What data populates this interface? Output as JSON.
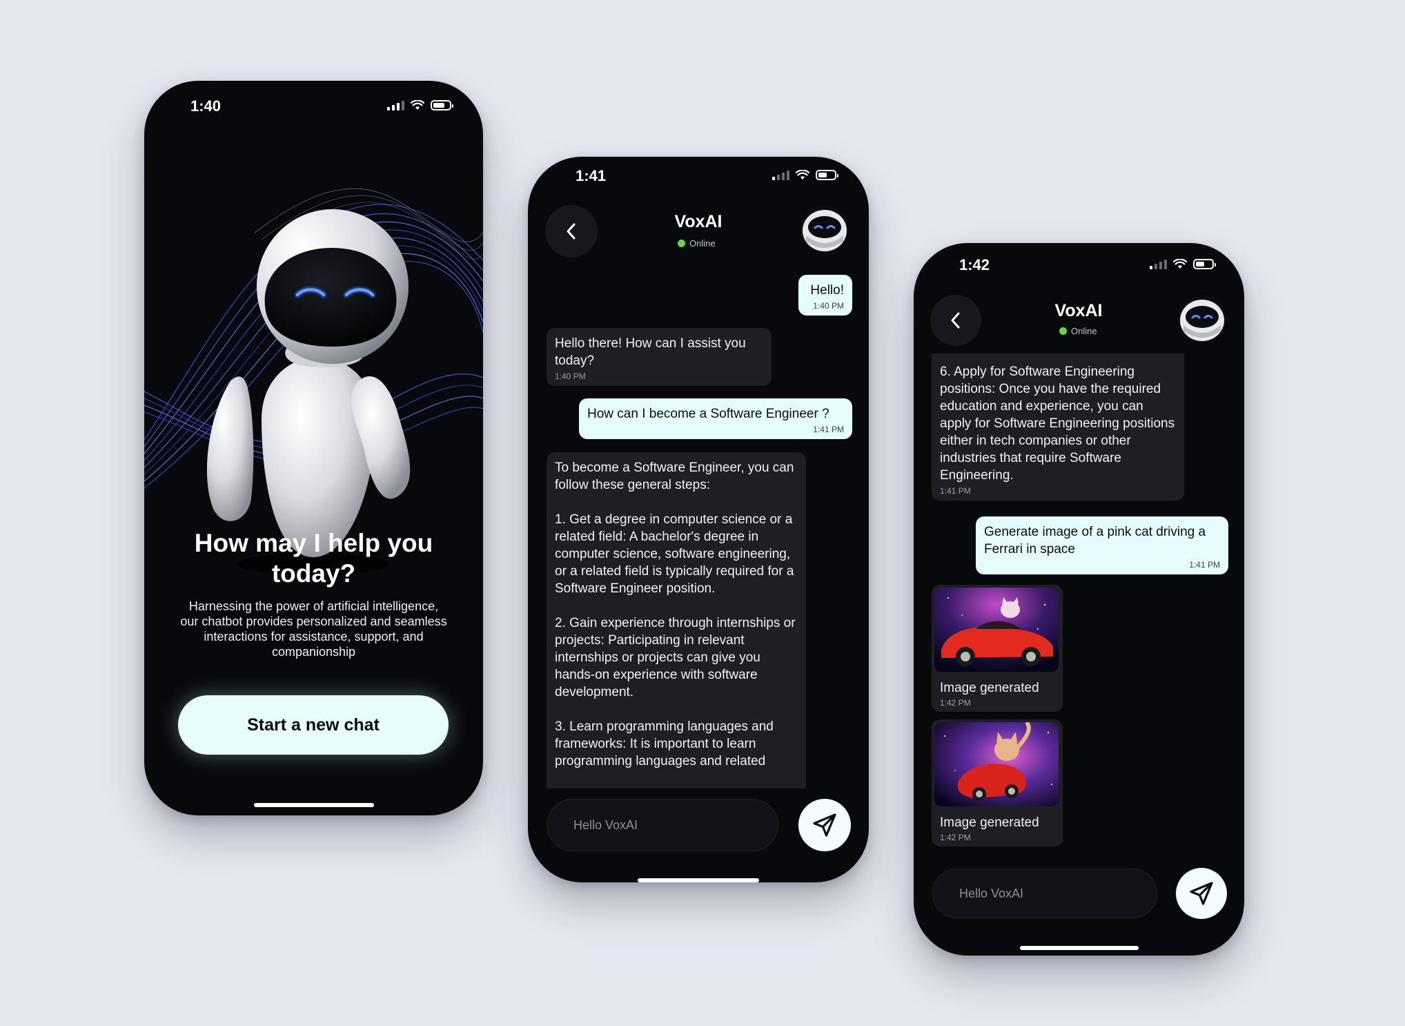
{
  "onboarding": {
    "time": "1:40",
    "title": "How may I help you today?",
    "subtitle": "Harnessing the power of artificial intelligence, our chatbot provides personalized and seamless interactions for assistance, support, and companionship",
    "start_button": "Start a new chat"
  },
  "chat1": {
    "time": "1:41",
    "name": "VoxAI",
    "status": "Online",
    "input_placeholder": "Hello VoxAI",
    "messages": [
      {
        "from": "user",
        "text": "Hello!",
        "ts": "1:40 PM"
      },
      {
        "from": "bot",
        "text": "Hello there! How can I assist you today?",
        "ts": "1:40 PM"
      },
      {
        "from": "user",
        "text": "How can I become a Software Engineer ?",
        "ts": "1:41 PM"
      },
      {
        "from": "bot",
        "text": "To become a Software Engineer, you can follow these general steps:\n\n1. Get a degree in computer science or a related field: A bachelor's degree in computer science, software engineering, or a related field is typically required for a Software Engineer position.\n\n2. Gain experience through internships or projects: Participating in relevant internships or projects can give you hands-on experience with software development.\n\n3. Learn programming languages and frameworks: It is important to learn programming languages and related",
        "ts": ""
      }
    ]
  },
  "chat2": {
    "time": "1:42",
    "name": "VoxAI",
    "status": "Online",
    "input_placeholder": "Hello VoxAI",
    "messages": [
      {
        "from": "bot",
        "text": "6. Apply for Software Engineering positions: Once you have the required education and experience, you can apply for Software Engineering positions either in tech companies or other industries that require Software Engineering.",
        "ts": "1:41 PM"
      },
      {
        "from": "user",
        "text": "Generate image of a pink cat driving a Ferrari in space",
        "ts": "1:41 PM"
      }
    ],
    "images": [
      {
        "caption": "Image generated",
        "ts": "1:42 PM"
      },
      {
        "caption": "Image generated",
        "ts": "1:42 PM"
      }
    ]
  }
}
